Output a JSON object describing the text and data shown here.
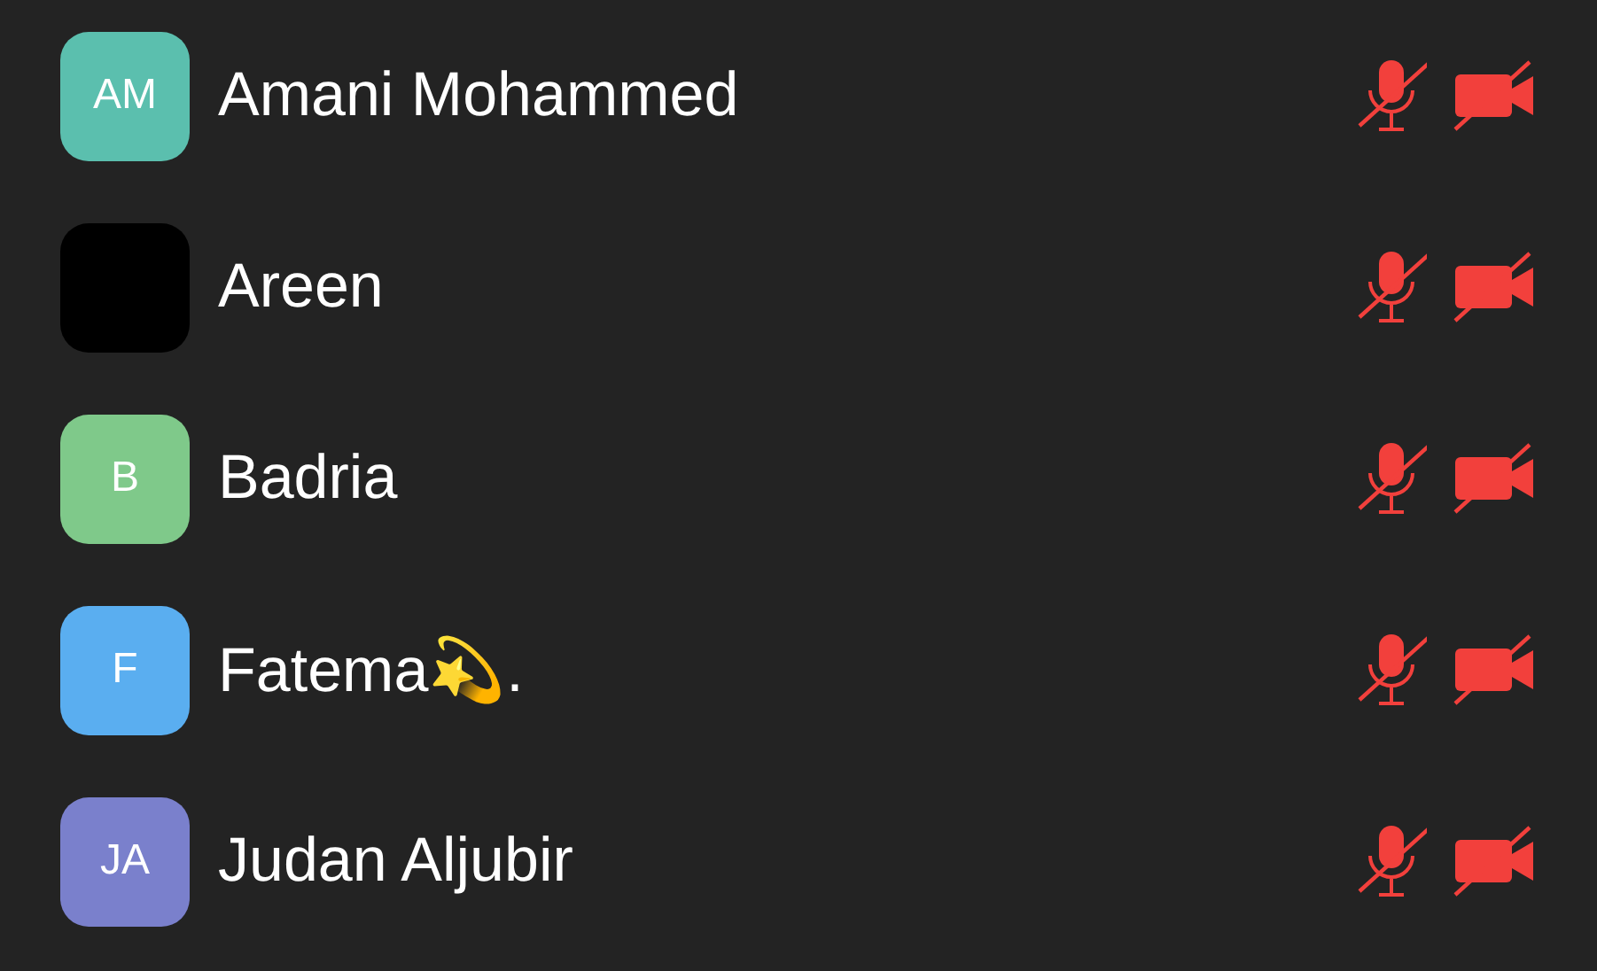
{
  "participants": [
    {
      "name": "Amani Mohammed",
      "initials": "AM",
      "color": "#5bbfae",
      "muted": true,
      "camera_off": true
    },
    {
      "name": "Areen",
      "color": "#000000",
      "muted": true,
      "camera_off": true
    },
    {
      "name": "Badria",
      "initials": "B",
      "color": "#7fc98a",
      "muted": true,
      "camera_off": true
    },
    {
      "name": "Fatema💫.",
      "initials": "F",
      "color": "#5aaef0",
      "muted": true,
      "camera_off": true
    },
    {
      "name": "Judan Aljubir",
      "initials": "JA",
      "color": "#7a80cc",
      "muted": true,
      "camera_off": true
    }
  ]
}
